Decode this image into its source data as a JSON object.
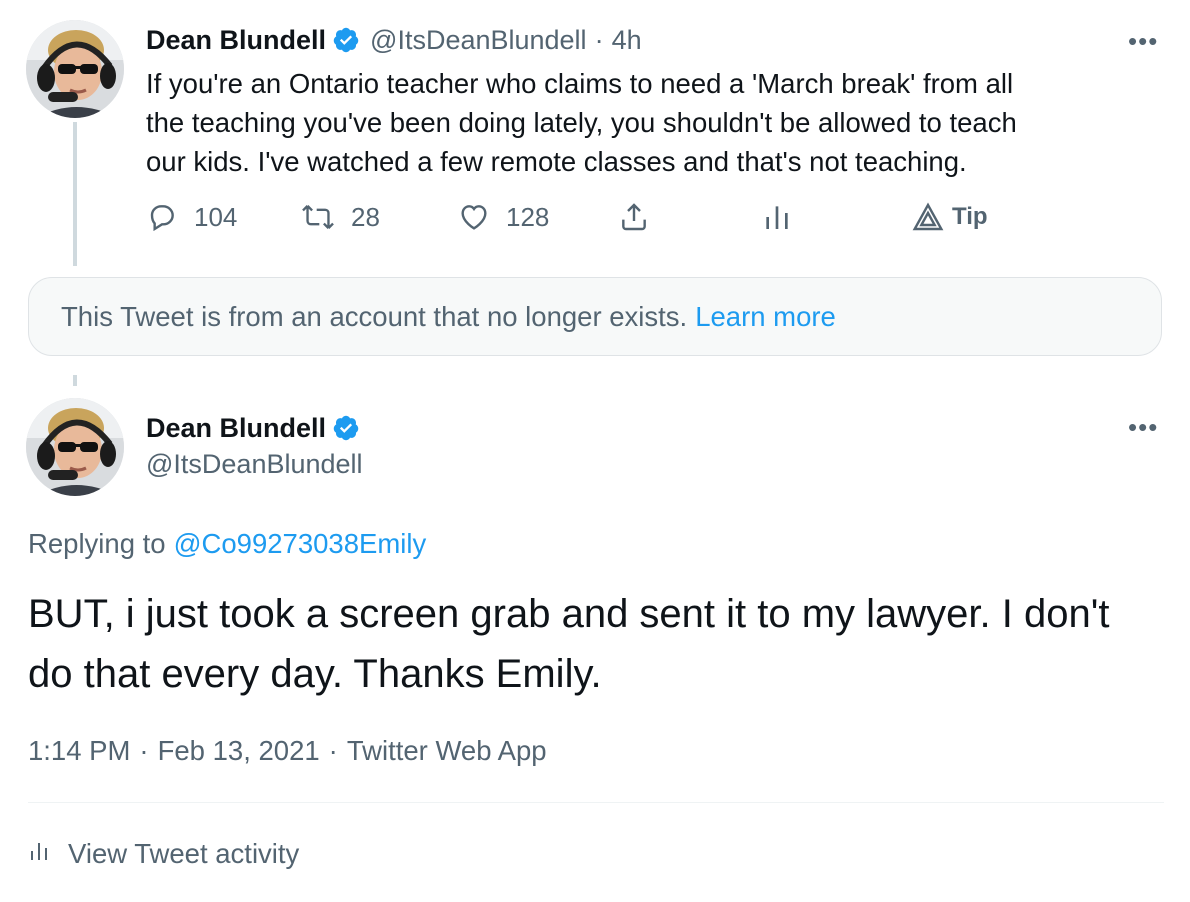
{
  "tweet1": {
    "author_name": "Dean Blundell",
    "handle": "@ItsDeanBlundell",
    "separator": "·",
    "time": "4h",
    "text": "If you're an Ontario teacher who claims to need a 'March break' from all\nthe teaching you've been doing lately, you shouldn't be allowed to teach\nour kids.  I've watched a few remote classes and that's not teaching.",
    "more_label": "•••",
    "actions": {
      "replies": "104",
      "retweets": "28",
      "likes": "128",
      "tip_label": "Tip"
    },
    "icons": [
      "reply-icon",
      "retweet-icon",
      "like-icon",
      "share-icon",
      "analytics-icon",
      "tip-icon"
    ]
  },
  "notice": {
    "text": "This Tweet is from an account that no longer exists.",
    "link_label": "Learn more"
  },
  "tweet2": {
    "author_name": "Dean Blundell",
    "handle": "@ItsDeanBlundell",
    "more_label": "•••",
    "replying_to_label": "Replying to",
    "replying_to_handle": "@Co99273038Emily",
    "text": "BUT, i just took a screen grab and sent it to my lawyer.  I don't do that every day.  Thanks Emily.",
    "time": "1:14 PM",
    "date": "Feb 13, 2021",
    "source": "Twitter Web App",
    "separator": "·",
    "activity_label": "View Tweet activity"
  },
  "colors": {
    "accent": "#1d9bf0",
    "secondary_text": "#536471",
    "primary_text": "#0f1419",
    "verified_badge": "#1d9bf0"
  }
}
